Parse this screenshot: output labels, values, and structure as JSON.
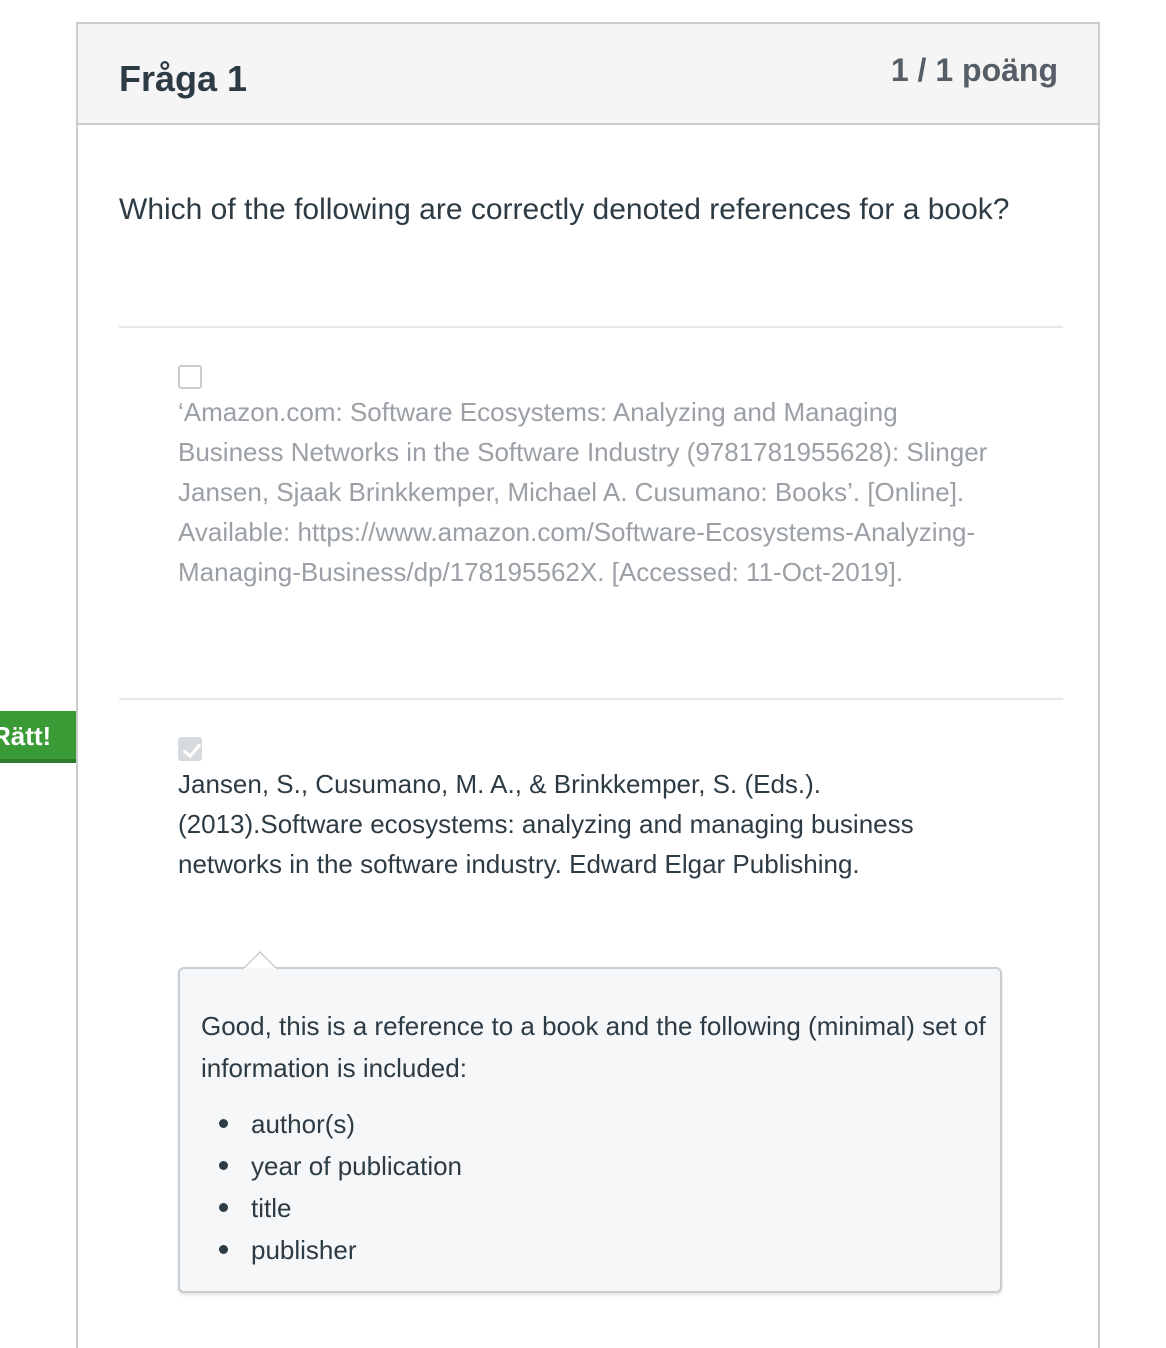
{
  "flag": {
    "label": "Rätt!",
    "color": "#3a9a35"
  },
  "question": {
    "title": "Fråga 1",
    "points": "1 / 1 poäng",
    "text": "Which of the following are correctly denoted references for a book?"
  },
  "answers": [
    {
      "selected": false,
      "text": "‘Amazon.com: Software Ecosystems: Analyzing and Managing Business Networks in the Software Industry (9781781955628): Slinger Jansen, Sjaak Brinkkemper, Michael A. Cusumano: Books’. [Online]. Available: https://www.amazon.com/Software-Ecosystems-Analyzing-Managing-Business/dp/178195562X. [Accessed: 11-Oct-2019]."
    },
    {
      "selected": true,
      "text": "Jansen, S., Cusumano, M. A., & Brinkkemper, S. (Eds.). (2013).Software ecosystems: analyzing and managing business networks in the software industry. Edward Elgar Publishing."
    }
  ],
  "comment": {
    "text": "Good, this is a reference to a book and the following (minimal) set of information is included:",
    "items": [
      "author(s)",
      "year of publication",
      "title",
      "publisher"
    ]
  }
}
